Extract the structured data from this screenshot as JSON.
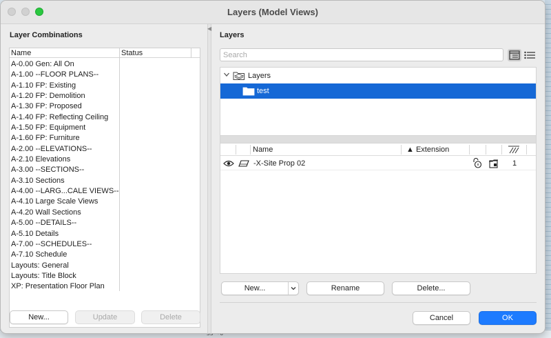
{
  "window": {
    "title": "Layers (Model Views)"
  },
  "left": {
    "title": "Layer Combinations",
    "columns": {
      "name": "Name",
      "status": "Status"
    },
    "items": [
      "A-0.00 Gen: All On",
      "A-1.00 --FLOOR PLANS--",
      "A-1.10 FP: Existing",
      "A-1.20 FP: Demolition",
      "A-1.30 FP: Proposed",
      "A-1.40 FP: Reflecting Ceiling",
      "A-1.50 FP: Equipment",
      "A-1.60 FP: Furniture",
      "A-2.00 --ELEVATIONS--",
      "A-2.10 Elevations",
      "A-3.00 --SECTIONS--",
      "A-3.10 Sections",
      "A-4.00 --LARG...CALE VIEWS--",
      "A-4.10 Large Scale Views",
      "A-4.20 Wall Sections",
      "A-5.00 --DETAILS--",
      "A-5.10 Details",
      "A-7.00 --SCHEDULES--",
      "A-7.10 Schedule",
      "Layouts: General",
      "Layouts: Title Block",
      "XP: Presentation Floor Plan"
    ],
    "buttons": {
      "new": "New...",
      "update": "Update",
      "delete": "Delete"
    }
  },
  "right": {
    "title": "Layers",
    "search": {
      "placeholder": "Search",
      "value": ""
    },
    "tree": {
      "root": "Layers",
      "selected": "test"
    },
    "table": {
      "columns": {
        "name": "Name",
        "extension": "Extension"
      },
      "sort_indicator": "▲",
      "rows": [
        {
          "name": "-X-Site Prop 02",
          "intersection_group": "1"
        }
      ]
    },
    "buttons": {
      "new": "New...",
      "rename": "Rename",
      "delete": "Delete..."
    }
  },
  "footer": {
    "cancel": "Cancel",
    "ok": "OK"
  },
  "backdrop": {
    "ruler_text": "35'-6\""
  },
  "colors": {
    "accent": "#1d7bff",
    "selection": "#1568d6",
    "zoom": "#2ac840"
  }
}
